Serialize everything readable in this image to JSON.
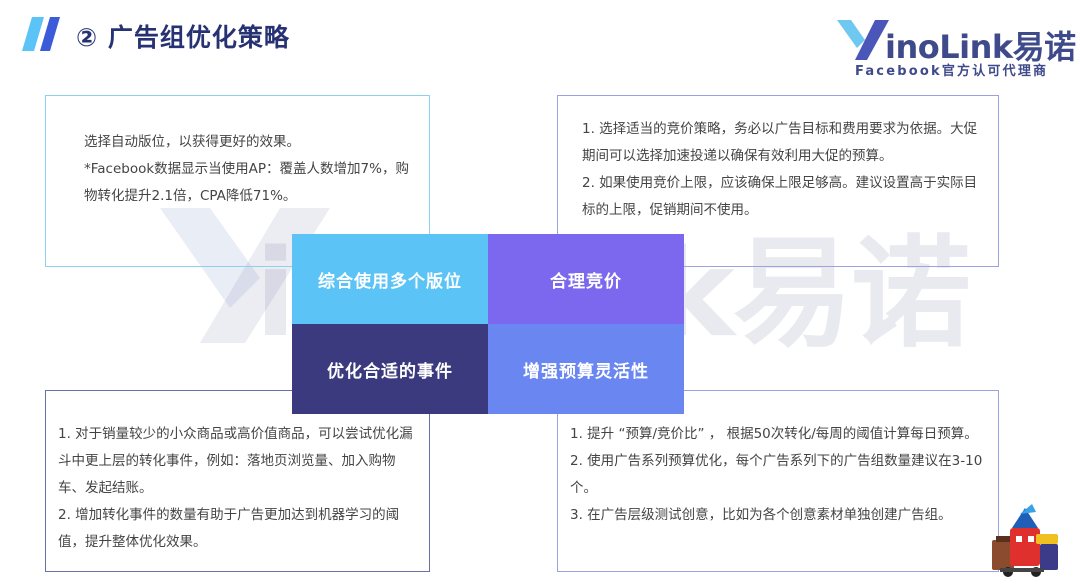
{
  "header": {
    "title": "② 广告组优化策略"
  },
  "logo": {
    "brand": "inoLink",
    "brand_cn": "易诺",
    "subtitle": "Facebook官方认可代理商"
  },
  "watermark": {
    "text": "inoLink易诺"
  },
  "quadrants": {
    "top_left": "综合使用多个版位",
    "top_right": "合理竞价",
    "bottom_left": "优化合适的事件",
    "bottom_right": "增强预算灵活性"
  },
  "boxes": {
    "top_left": [
      "选择自动版位，以获得更好的效果。",
      "*Facebook数据显示当使用AP：覆盖人数增加7%，购物转化提升2.1倍，CPA降低71%。"
    ],
    "top_right": [
      "1. 选择适当的竞价策略，务必以广告目标和费用要求为依据。大促期间可以选择加速投递以确保有效利用大促的预算。",
      "2. 如果使用竞价上限，应该确保上限足够高。建议设置高于实际目标的上限，促销期间不使用。"
    ],
    "bottom_left": [
      "1. 对于销量较少的小众商品或高价值商品，可以尝试优化漏斗中更上层的转化事件，例如：落地页浏览量、加入购物车、发起结账。",
      "2. 增加转化事件的数量有助于广告更加达到机器学习的阈值，提升整体优化效果。"
    ],
    "bottom_right": [
      "1. 提升 “预算/竞价比” ， 根据50次转化/每周的阈值计算每日预算。",
      "2. 使用广告系列预算优化，每个广告系列下的广告组数量建议在3-10个。",
      "3. 在广告层级测试创意，比如为各个创意素材单独创建广告组。"
    ]
  },
  "colors": {
    "title": "#273272",
    "quad_top_left": "#5bc3f5",
    "quad_top_right": "#7b68ee",
    "quad_bottom_left": "#3c3a7e",
    "quad_bottom_right": "#6a87f1"
  },
  "icons": {
    "title_mark": "double-slash-icon",
    "mascot": "mascot-illustration"
  }
}
